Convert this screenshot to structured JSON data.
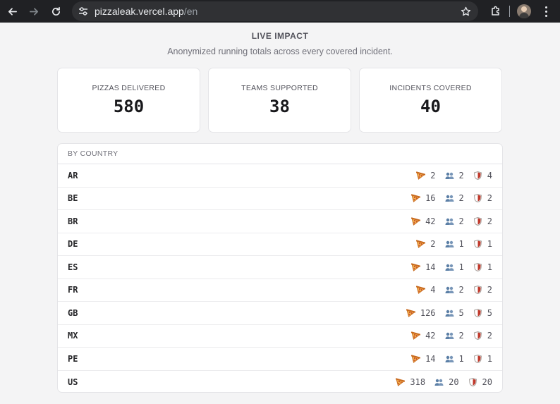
{
  "browser": {
    "url_host": "pizzaleak.vercel.app",
    "url_path": "/en"
  },
  "impact": {
    "title": "LIVE IMPACT",
    "subtitle": "Anonymized running totals across every covered incident.",
    "stats": [
      {
        "label": "PIZZAS DELIVERED",
        "value": "580"
      },
      {
        "label": "TEAMS SUPPORTED",
        "value": "38"
      },
      {
        "label": "INCIDENTS COVERED",
        "value": "40"
      }
    ]
  },
  "by_country": {
    "header": "BY COUNTRY",
    "rows": [
      {
        "code": "AR",
        "pizzas": "2",
        "teams": "2",
        "incidents": "4"
      },
      {
        "code": "BE",
        "pizzas": "16",
        "teams": "2",
        "incidents": "2"
      },
      {
        "code": "BR",
        "pizzas": "42",
        "teams": "2",
        "incidents": "2"
      },
      {
        "code": "DE",
        "pizzas": "2",
        "teams": "1",
        "incidents": "1"
      },
      {
        "code": "ES",
        "pizzas": "14",
        "teams": "1",
        "incidents": "1"
      },
      {
        "code": "FR",
        "pizzas": "4",
        "teams": "2",
        "incidents": "2"
      },
      {
        "code": "GB",
        "pizzas": "126",
        "teams": "5",
        "incidents": "5"
      },
      {
        "code": "MX",
        "pizzas": "42",
        "teams": "2",
        "incidents": "2"
      },
      {
        "code": "PE",
        "pizzas": "14",
        "teams": "1",
        "incidents": "1"
      },
      {
        "code": "US",
        "pizzas": "318",
        "teams": "20",
        "incidents": "20"
      }
    ]
  },
  "icons": {
    "back": "arrow-left-icon",
    "forward": "arrow-right-icon",
    "reload": "reload-icon",
    "site_info": "tune-icon",
    "bookmark": "star-icon",
    "extensions": "puzzle-icon",
    "menu": "kebab-menu-icon",
    "pizza": "pizza-icon",
    "teams": "people-icon",
    "incidents": "shield-icon"
  },
  "colors": {
    "chrome_bg": "#202124",
    "omnibox_bg": "#303134",
    "page_bg": "#f4f4f5",
    "card_border": "#e4e4e7",
    "pizza_orange": "#e07a2a",
    "people_blue": "#5b7fa6",
    "shield_red": "#c0392b"
  }
}
